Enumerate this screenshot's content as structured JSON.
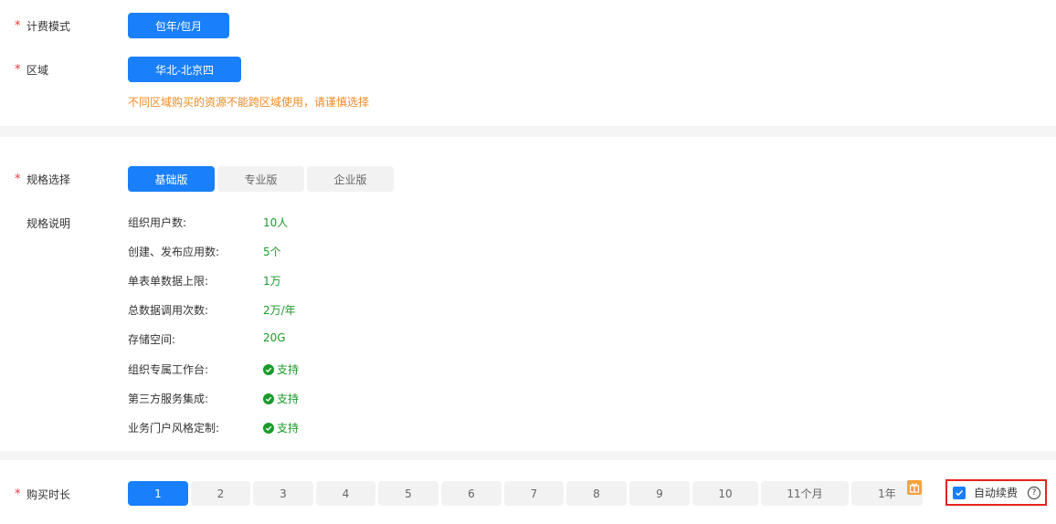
{
  "billing": {
    "label": "计费模式",
    "value": "包年/包月"
  },
  "region": {
    "label": "区域",
    "value": "华北-北京四",
    "notice": "不同区域购买的资源不能跨区域使用，请谨慎选择"
  },
  "spec": {
    "label": "规格选择",
    "tabs": [
      {
        "label": "基础版",
        "active": true
      },
      {
        "label": "专业版",
        "active": false
      },
      {
        "label": "企业版",
        "active": false
      }
    ]
  },
  "spec_desc": {
    "label": "规格说明",
    "items": [
      {
        "name": "组织用户数:",
        "value": "10人"
      },
      {
        "name": "创建、发布应用数:",
        "value": "5个"
      },
      {
        "name": "单表单数据上限:",
        "value": "1万"
      },
      {
        "name": "总数据调用次数:",
        "value": "2万/年"
      },
      {
        "name": "存储空间:",
        "value": "20G"
      },
      {
        "name": "组织专属工作台:",
        "value": "支持"
      },
      {
        "name": "第三方服务集成:",
        "value": "支持"
      },
      {
        "name": "业务门户风格定制:",
        "value": "支持"
      }
    ]
  },
  "duration": {
    "label": "购买时长",
    "options": [
      "1",
      "2",
      "3",
      "4",
      "5",
      "6",
      "7",
      "8",
      "9",
      "10",
      "11个月",
      "1年"
    ],
    "selected": "1"
  },
  "auto_renew": {
    "label": "自动续费",
    "checked": true
  },
  "colors": {
    "primary": "#1a7ffb",
    "success": "#1a9a2a",
    "warning": "#f08a24",
    "required": "#e4393c",
    "highlight_border": "#e8231c"
  }
}
